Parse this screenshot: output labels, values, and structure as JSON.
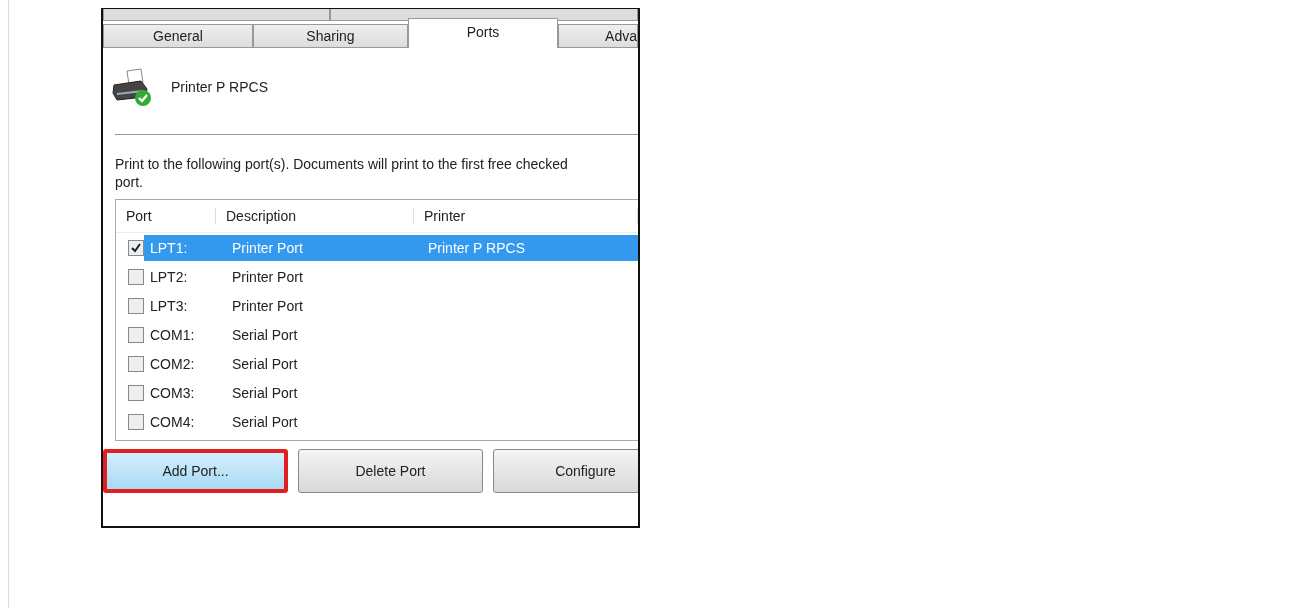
{
  "tabs_top_row": [
    {
      "kind": "tab"
    },
    {
      "kind": "tab"
    }
  ],
  "tabs": [
    {
      "label": "General",
      "selected": false
    },
    {
      "label": "Sharing",
      "selected": false
    },
    {
      "label": "Ports",
      "selected": true
    },
    {
      "label": "Adva",
      "selected": false
    }
  ],
  "printer_name": "Printer P RPCS",
  "instructions": "Print to the following port(s). Documents will print to the first free checked port.",
  "table": {
    "columns": [
      "Port",
      "Description",
      "Printer"
    ],
    "rows": [
      {
        "port": "LPT1:",
        "description": "Printer Port",
        "printer": "Printer P RPCS",
        "checked": true,
        "selected": true
      },
      {
        "port": "LPT2:",
        "description": "Printer Port",
        "printer": "",
        "checked": false,
        "selected": false
      },
      {
        "port": "LPT3:",
        "description": "Printer Port",
        "printer": "",
        "checked": false,
        "selected": false
      },
      {
        "port": "COM1:",
        "description": "Serial Port",
        "printer": "",
        "checked": false,
        "selected": false
      },
      {
        "port": "COM2:",
        "description": "Serial Port",
        "printer": "",
        "checked": false,
        "selected": false
      },
      {
        "port": "COM3:",
        "description": "Serial Port",
        "printer": "",
        "checked": false,
        "selected": false
      },
      {
        "port": "COM4:",
        "description": "Serial Port",
        "printer": "",
        "checked": false,
        "selected": false
      }
    ]
  },
  "buttons": [
    {
      "label": "Add Port...",
      "highlighted": true
    },
    {
      "label": "Delete Port",
      "highlighted": false
    },
    {
      "label": "Configure",
      "highlighted": false
    }
  ]
}
